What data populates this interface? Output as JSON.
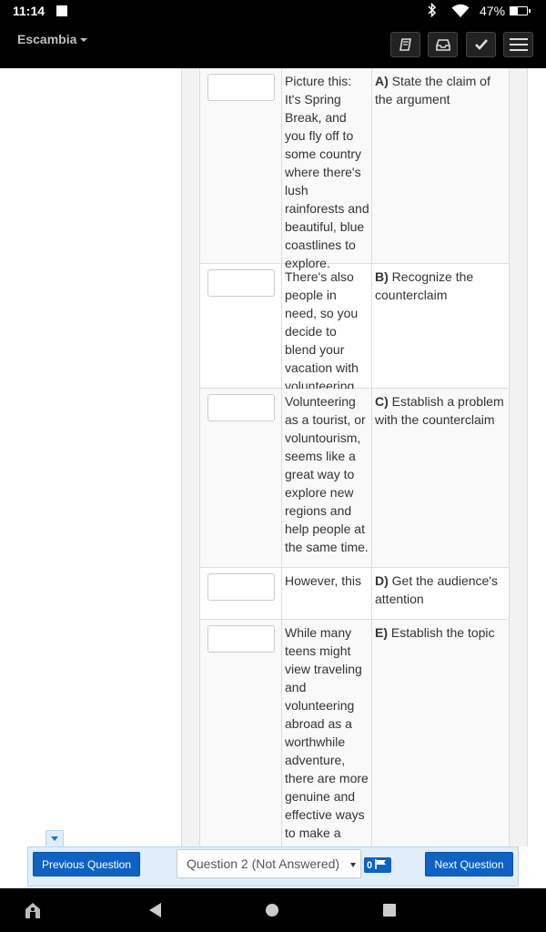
{
  "status_bar": {
    "time": "11:14",
    "battery_percent": "47%",
    "icons": [
      "notification-square-icon",
      "bluetooth-icon",
      "wifi-icon",
      "battery-charging-icon"
    ]
  },
  "header": {
    "brand": "Escambia",
    "buttons": [
      "book-icon",
      "inbox-icon",
      "check-icon",
      "menu-icon"
    ]
  },
  "matching": {
    "rows": [
      {
        "prompt": "Picture this: It's Spring Break, and you fly off to some country where there's lush rainforests and beautiful, blue coastlines to explore.",
        "letter": "A)",
        "choice": "State the claim of the argument"
      },
      {
        "prompt": "There's also people in need, so you decide to blend your vacation with volunteering.",
        "letter": "B)",
        "choice": "Recognize the counterclaim"
      },
      {
        "prompt": "Volunteering as a tourist, or voluntourism, seems like a great way to explore new regions and help people at the same time.",
        "letter": "C)",
        "choice": "Establish a problem with the counterclaim"
      },
      {
        "prompt": "However, this",
        "letter": "D)",
        "choice": "Get the audience's attention"
      },
      {
        "prompt": "While many teens might view traveling and volunteering abroad as a worthwhile adventure, there are more genuine and effective ways to make a",
        "letter": "E)",
        "choice": "Establish the topic"
      }
    ]
  },
  "bottom_nav": {
    "previous_label": "Previous Question",
    "question_select": "Question 2 (Not Answered)",
    "flag_count": "0",
    "next_label": "Next Question"
  },
  "system_nav": {
    "buttons": [
      "accessibility-icon",
      "back-icon",
      "home-icon",
      "recents-icon"
    ]
  }
}
